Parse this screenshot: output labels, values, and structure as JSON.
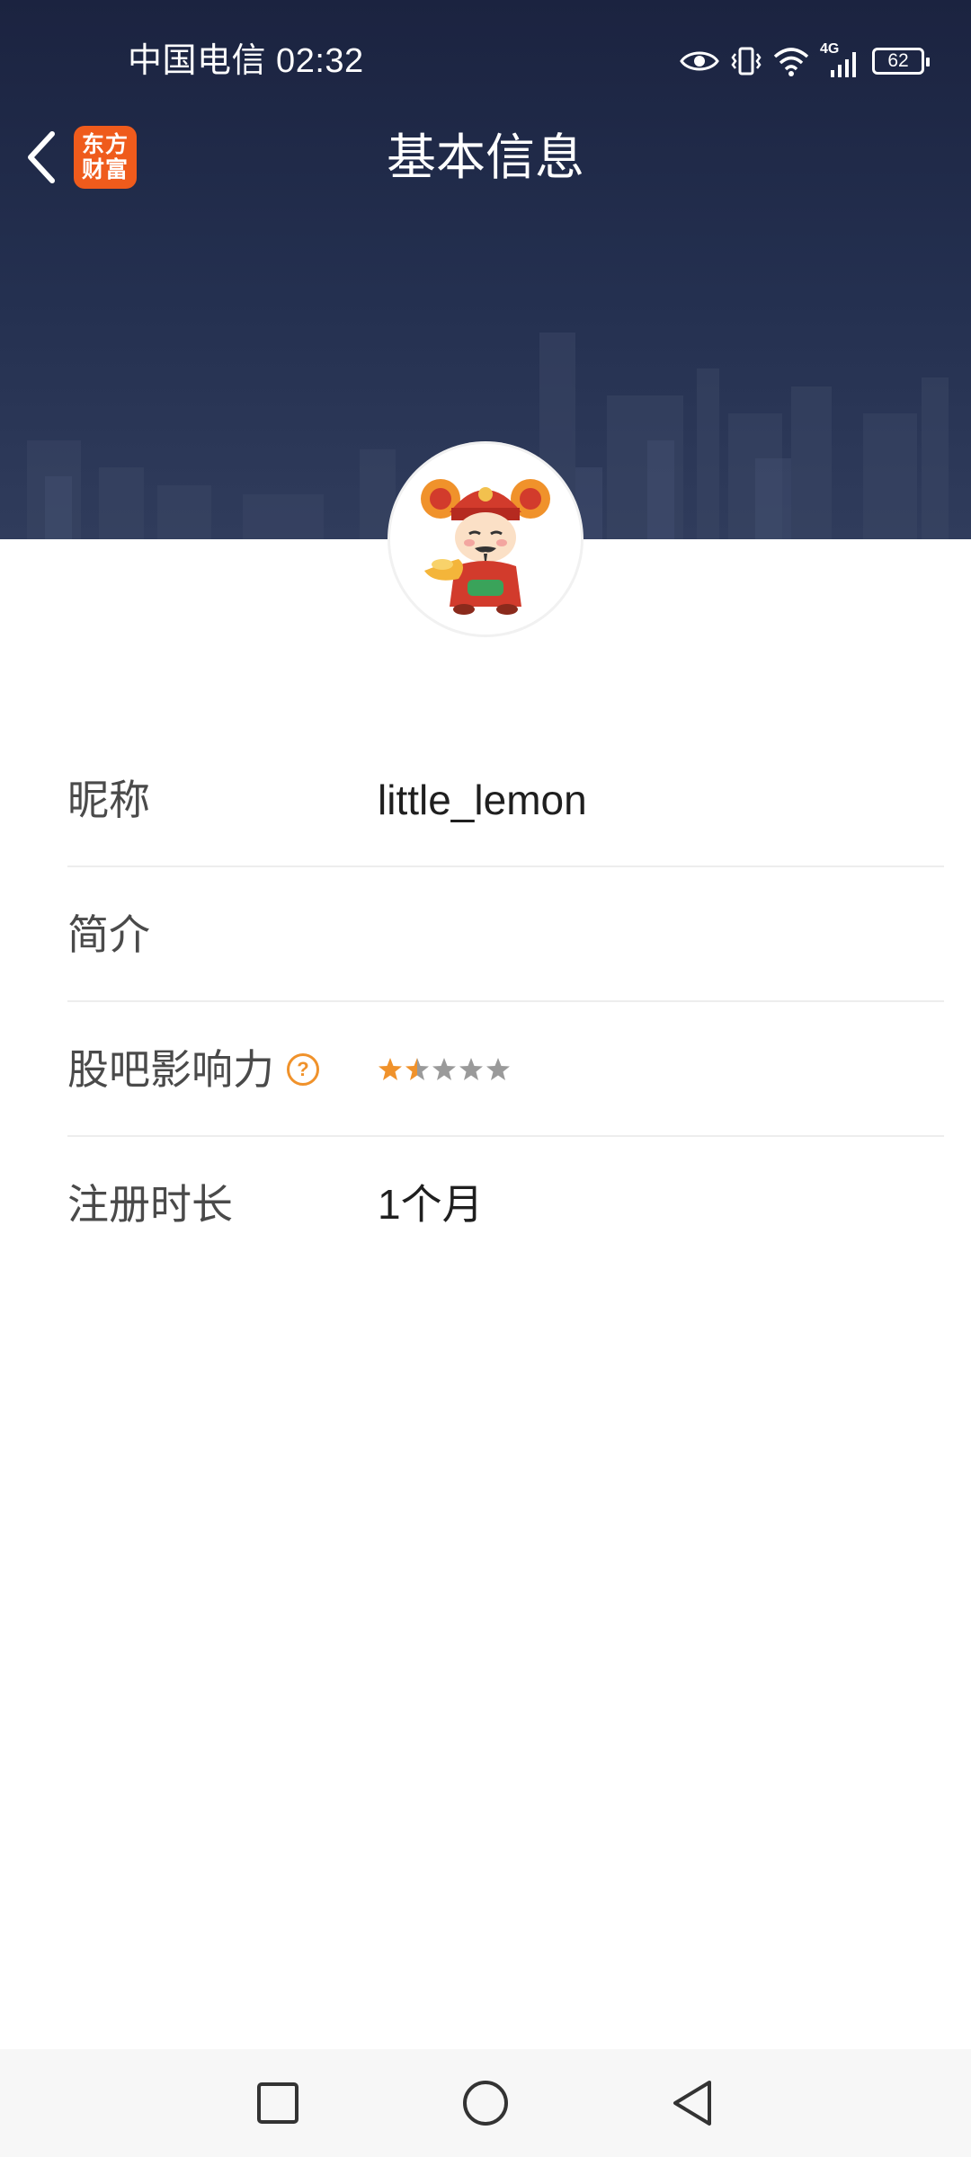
{
  "status_bar": {
    "carrier_time": "中国电信 02:32",
    "network": "4G",
    "battery": "62",
    "icons": [
      "eye-icon",
      "vibrate-icon",
      "wifi-icon",
      "signal-icon",
      "battery-icon"
    ]
  },
  "header": {
    "title": "基本信息",
    "back_icon": "chevron-left-icon",
    "logo_line1": "东方",
    "logo_line2": "财富"
  },
  "profile": {
    "avatar_icon": "god-of-wealth-avatar"
  },
  "info": {
    "nickname_label": "昵称",
    "nickname_value": "little_lemon",
    "intro_label": "简介",
    "intro_value": "",
    "influence_label": "股吧影响力",
    "influence_help": "?",
    "influence_rating": 1.5,
    "influence_max": 5,
    "register_label": "注册时长",
    "register_value": "1个月"
  },
  "colors": {
    "header_bg": "#1b2340",
    "logo_bg": "#ef5b1c",
    "star_active": "#f0922b",
    "star_inactive": "#9a9a9a"
  },
  "system_nav": {
    "icons": [
      "recent-apps-icon",
      "home-icon",
      "back-icon"
    ]
  }
}
